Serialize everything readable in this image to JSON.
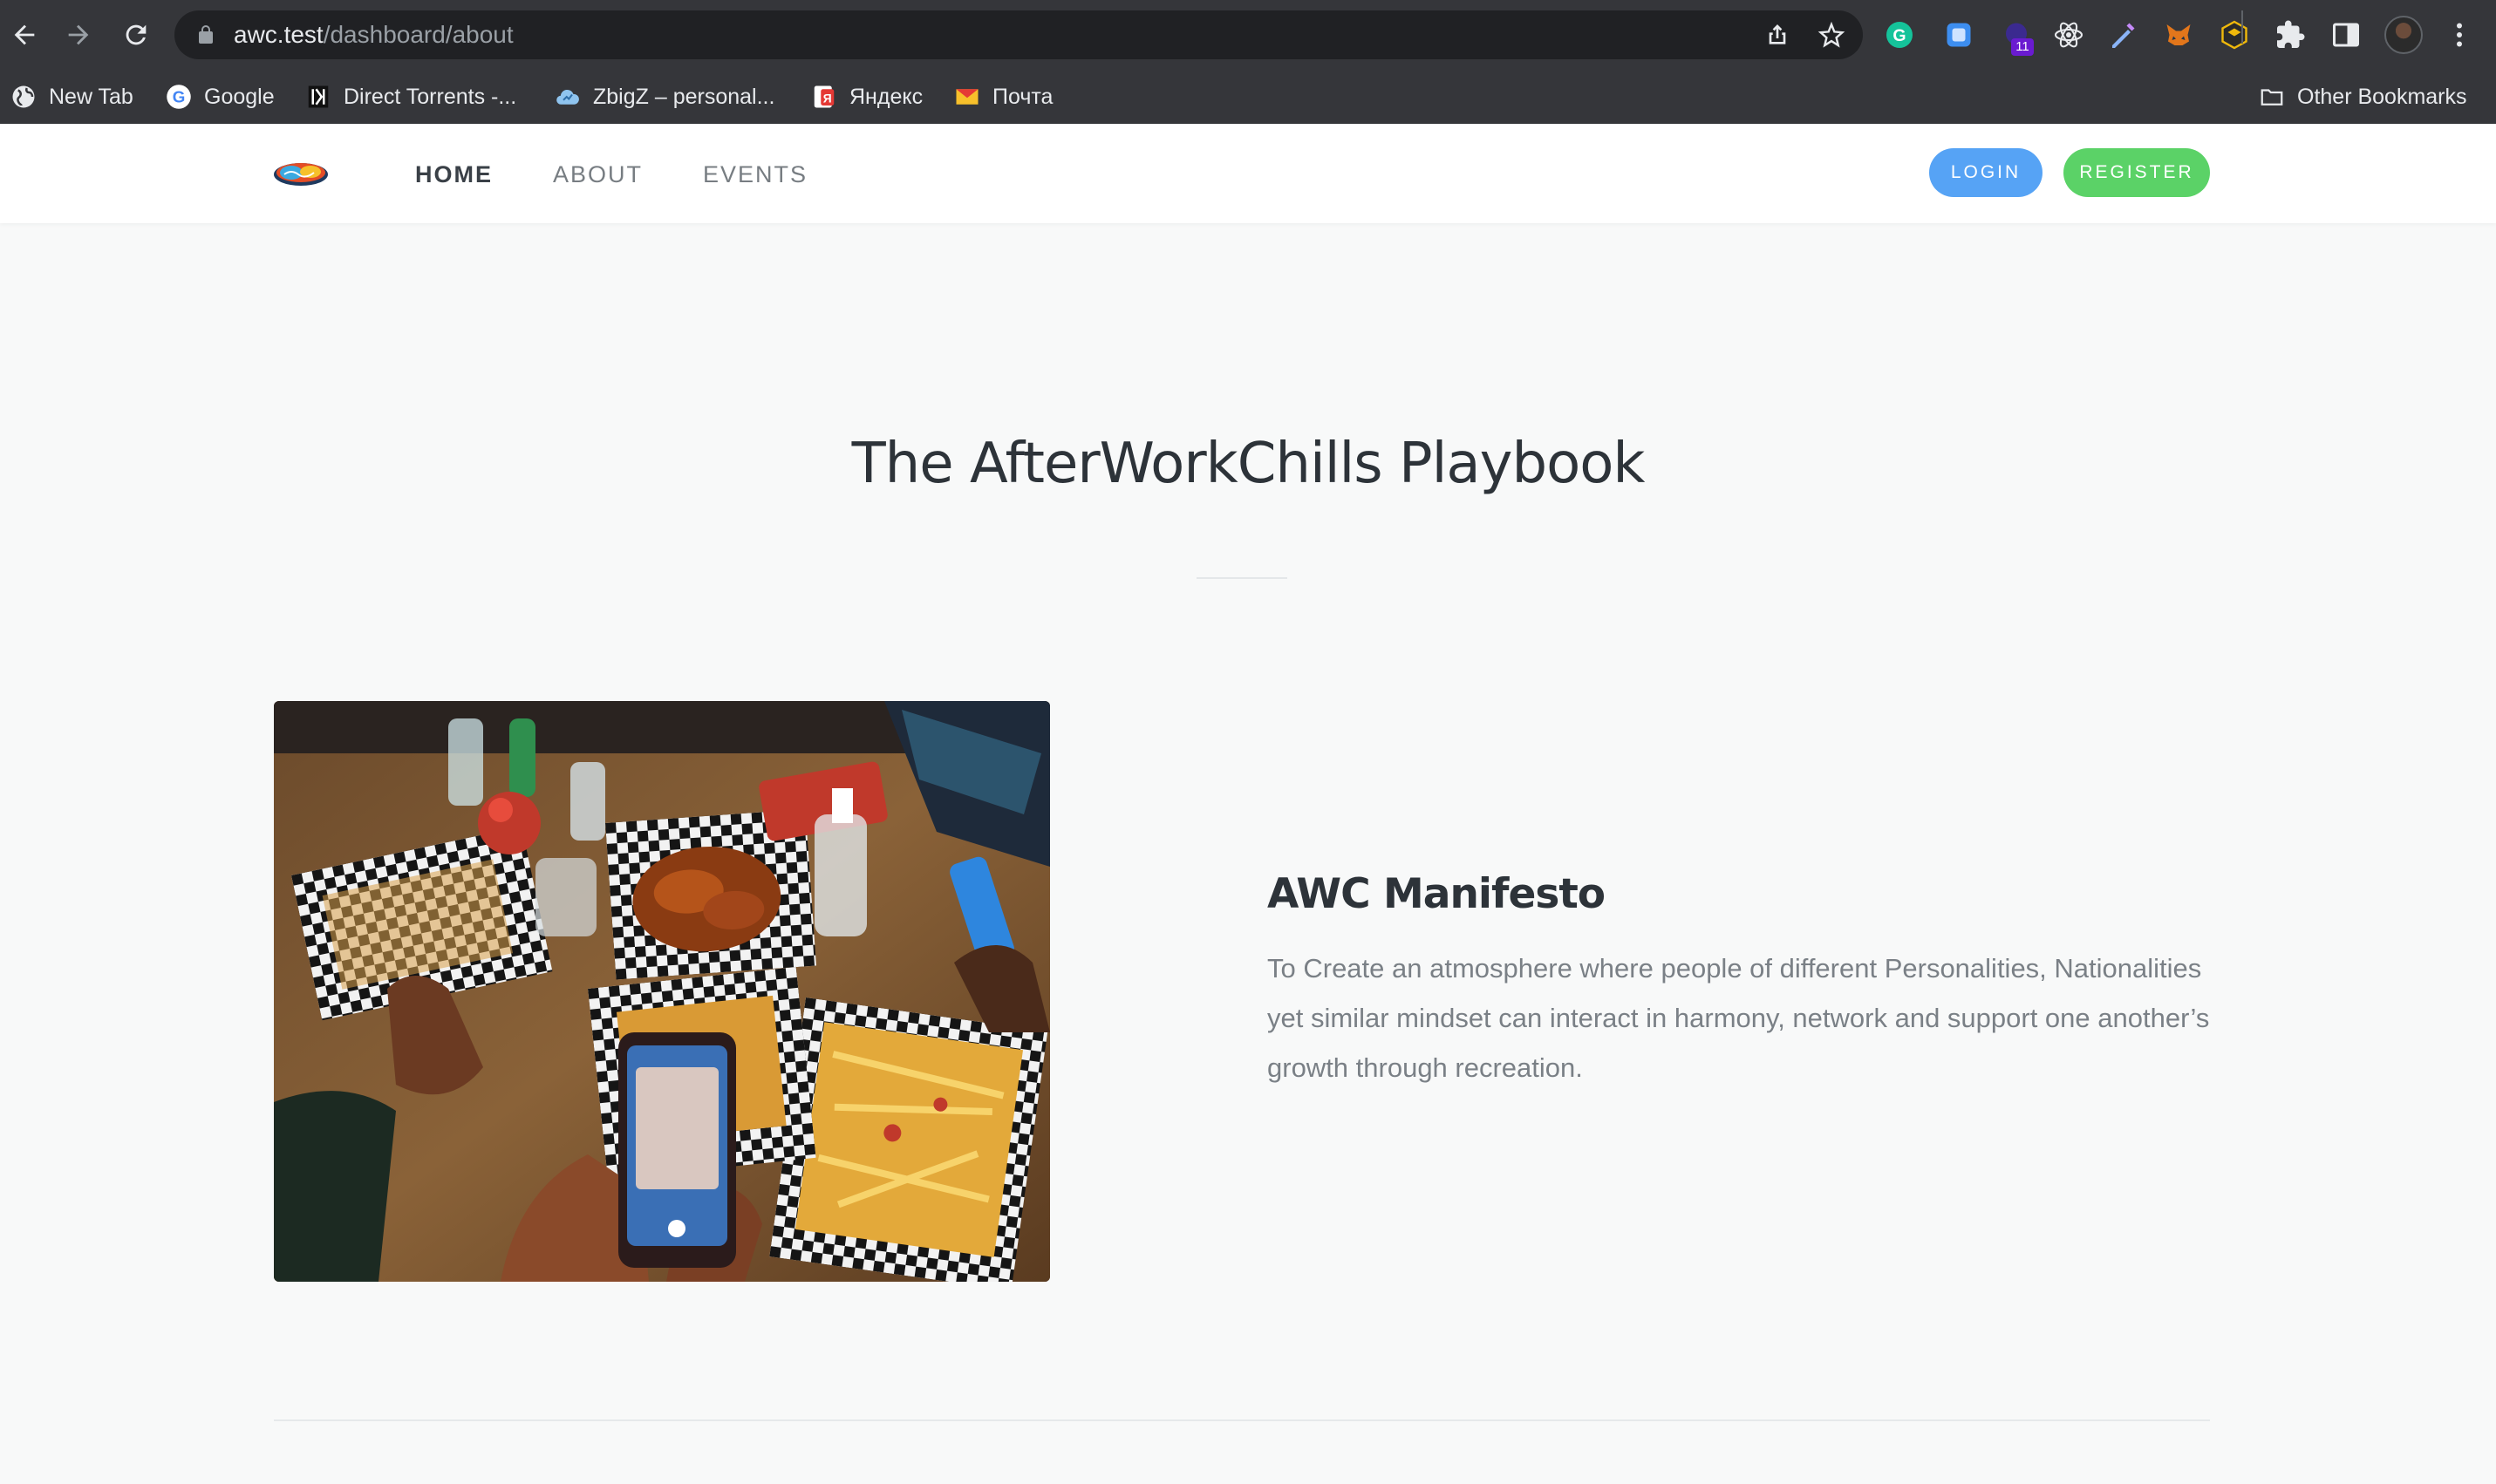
{
  "browser": {
    "url_host": "awc.test",
    "url_path": "/dashboard/about",
    "extension_badge": "11",
    "bookmarks": [
      {
        "label": "New Tab",
        "icon": "globe-icon"
      },
      {
        "label": "Google",
        "icon": "google-icon"
      },
      {
        "label": "Direct Torrents -...",
        "icon": "torrent-icon"
      },
      {
        "label": "ZbigZ – personal...",
        "icon": "cloud-icon"
      },
      {
        "label": "Яндекс",
        "icon": "yandex-icon"
      },
      {
        "label": "Почта",
        "icon": "mail-icon"
      }
    ],
    "other_bookmarks": "Other Bookmarks"
  },
  "site": {
    "nav": [
      {
        "label": "HOME",
        "active": true
      },
      {
        "label": "ABOUT",
        "active": false
      },
      {
        "label": "EVENTS",
        "active": false
      }
    ],
    "login_label": "LOGIN",
    "register_label": "REGISTER",
    "colors": {
      "login": "#56a3f5",
      "register": "#5bd267",
      "heading": "#2d3339",
      "body_text": "#7a8086"
    }
  },
  "main": {
    "title": "The AfterWorkChills Playbook",
    "section_heading": "AWC Manifesto",
    "section_body": "To Create an atmosphere where people of different Personalities, Nationalities yet similar mindset can interact in harmony, network and support one another’s growth through recreation."
  }
}
